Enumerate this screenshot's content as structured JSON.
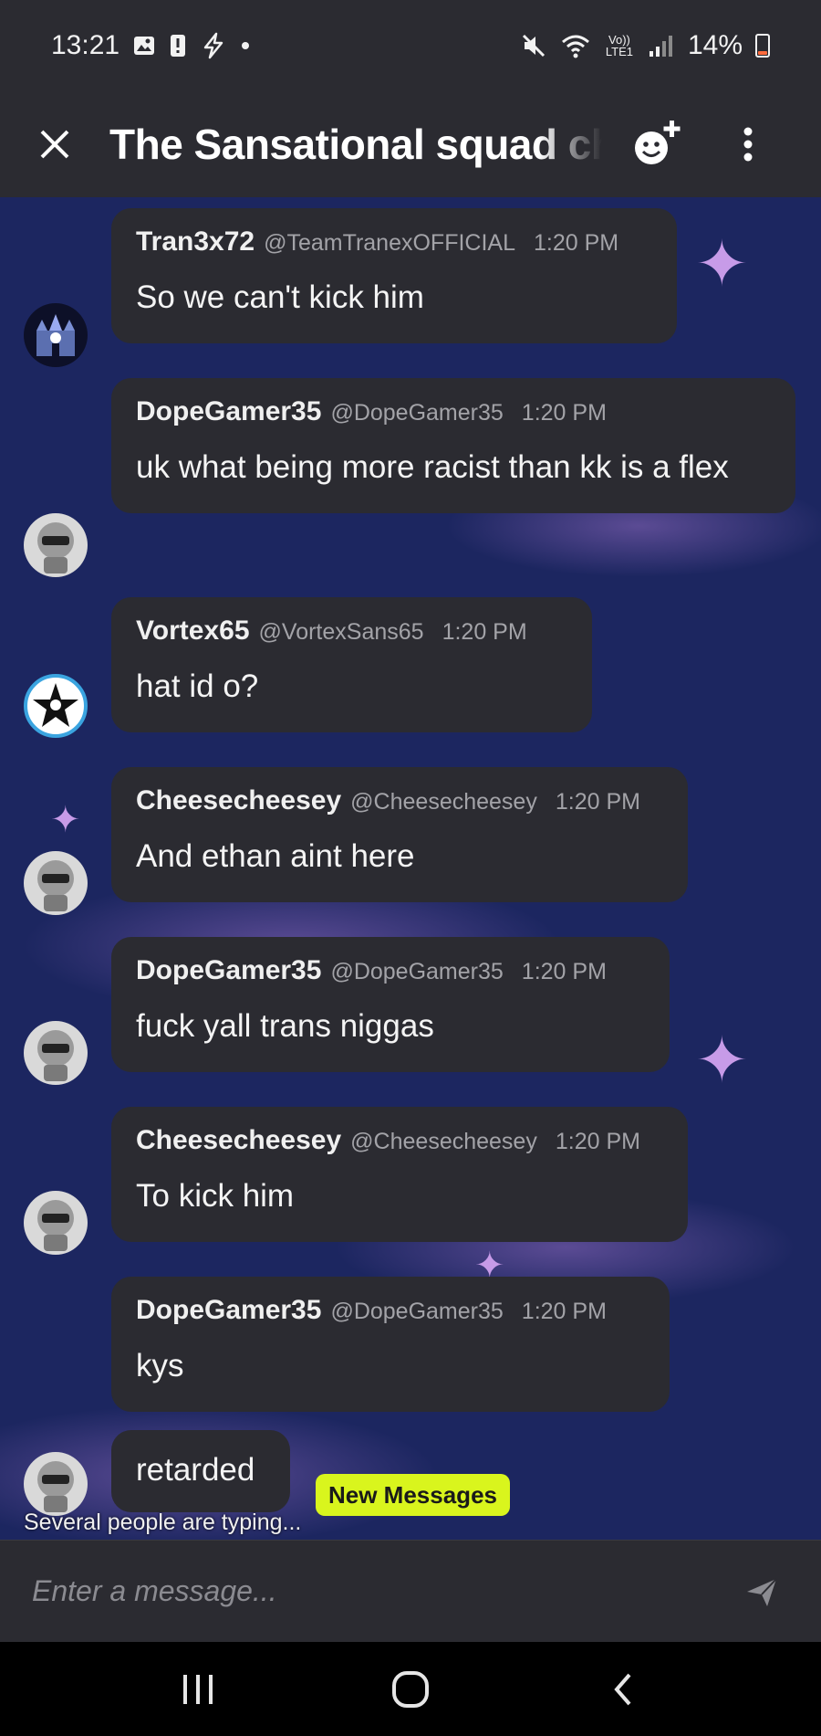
{
  "status_bar": {
    "time": "13:21",
    "network_label": "Vo)) LTE1",
    "battery_percent": "14%"
  },
  "header": {
    "title": "The Sansational squad chat",
    "close_icon": "close-icon",
    "add_member_icon": "add-member-icon",
    "more_icon": "more-vertical-icon"
  },
  "messages": [
    {
      "username": "Tran3x72",
      "handle": "@TeamTranexOFFICIAL",
      "time": "1:20 PM",
      "text": "So we can't kick him"
    },
    {
      "username": "DopeGamer35",
      "handle": "@DopeGamer35",
      "time": "1:20 PM",
      "text": "uk what being more racist than kk is a flex"
    },
    {
      "username": "Vortex65",
      "handle": "@VortexSans65",
      "time": "1:20 PM",
      "text": "hat id o?"
    },
    {
      "username": "Cheesecheesey",
      "handle": "@Cheesecheesey",
      "time": "1:20 PM",
      "text": "And ethan aint here"
    },
    {
      "username": "DopeGamer35",
      "handle": "@DopeGamer35",
      "time": "1:20 PM",
      "text": "fuck yall trans niggas"
    },
    {
      "username": "Cheesecheesey",
      "handle": "@Cheesecheesey",
      "time": "1:20 PM",
      "text": "To kick him"
    },
    {
      "username": "DopeGamer35",
      "handle": "@DopeGamer35",
      "time": "1:20 PM",
      "text": "kys"
    },
    {
      "username": "",
      "handle": "",
      "time": "",
      "text": "retarded"
    }
  ],
  "typing_indicator": "Several people are typing...",
  "new_messages_label": "New Messages",
  "composer": {
    "placeholder": "Enter a message...",
    "send_icon": "send-icon"
  },
  "colors": {
    "background": "#2b2b31",
    "chat_wallpaper": "#1c2660",
    "new_messages_badge": "#d9f51d",
    "battery_low": "#ff6b3d"
  }
}
